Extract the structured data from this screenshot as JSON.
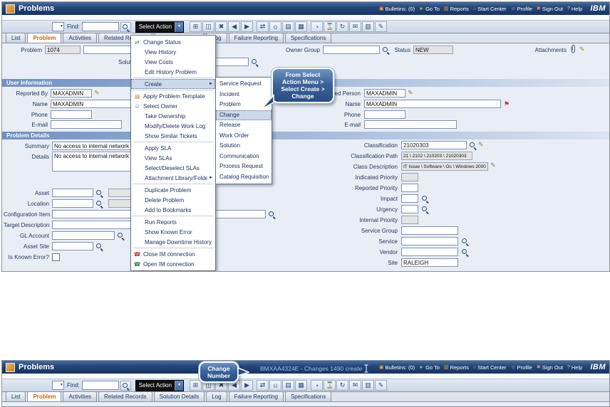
{
  "colors": {
    "titlebar": "#16335f",
    "section_header": "#7191c1",
    "active_tab_text": "#c4670f",
    "callout": "#274e83",
    "status_message_text": "#9fc2ea"
  },
  "header": {
    "app_title": "Problems",
    "logo": "IBM",
    "links": [
      {
        "label": "Bulletins: (0)",
        "glyph": "▣"
      },
      {
        "label": "Go To",
        "glyph": "►"
      },
      {
        "label": "Reports",
        "glyph": "▥"
      },
      {
        "label": "Start Center",
        "glyph": "⌂"
      },
      {
        "label": "Profile",
        "glyph": "☺"
      },
      {
        "label": "Sign Out",
        "glyph": "✖"
      },
      {
        "label": "Help",
        "glyph": "?"
      }
    ]
  },
  "toolbar": {
    "find_label": "Find:",
    "find_value": "",
    "select_action_label": "Select Action",
    "icons": [
      {
        "name": "new-record-icon",
        "glyph": "⊞"
      },
      {
        "name": "save-icon",
        "glyph": "◫"
      },
      {
        "name": "clear-changes-icon",
        "glyph": "✖"
      },
      {
        "name": "previous-record-icon",
        "glyph": "◀"
      },
      {
        "name": "next-record-icon",
        "glyph": "▶"
      },
      {
        "name": "change-status-icon",
        "glyph": "⇄"
      },
      {
        "name": "select-owner-icon",
        "glyph": "☺"
      },
      {
        "name": "detail-menu-icon",
        "glyph": "▤"
      },
      {
        "name": "kpi-icon",
        "glyph": "▦"
      },
      {
        "name": "schedule-icon",
        "glyph": "◔"
      },
      {
        "name": "timer-icon",
        "glyph": "⌛"
      },
      {
        "name": "refresh-icon",
        "glyph": "↻"
      },
      {
        "name": "communication-icon",
        "glyph": "✉"
      },
      {
        "name": "reports-icon",
        "glyph": "▥"
      },
      {
        "name": "edit-icon",
        "glyph": "✎"
      }
    ]
  },
  "tabs": [
    {
      "label": "List"
    },
    {
      "label": "Problem"
    },
    {
      "label": "Activities"
    },
    {
      "label": "Related Records"
    },
    {
      "label": "Solution Details"
    },
    {
      "label": "Log"
    },
    {
      "label": "Failure Reporting"
    },
    {
      "label": "Specifications"
    }
  ],
  "record": {
    "problem_label": "Problem",
    "problem_value": "1074",
    "problem_description_value": "",
    "solution_label": "Solution",
    "solution_value": "",
    "owner_group_label": "Owner Group",
    "owner_group_value": "",
    "status_label": "Status",
    "status_value": "NEW",
    "attachments_label": "Attachments"
  },
  "user_information": {
    "title": "User Information",
    "reported_by_label": "Reported By",
    "reported_by_value": "MAXADMIN",
    "name_label": "Name",
    "name_value": "MAXADMIN",
    "phone_label": "Phone",
    "phone_value": "",
    "email_label": "E-mail",
    "email_value": "",
    "affected_person_label": "Affected Person",
    "affected_person_value": "MAXADMIN",
    "affected_name_label": "Name",
    "affected_name_value": "MAXADMIN",
    "affected_phone_label": "Phone",
    "affected_phone_value": "",
    "affected_email_label": "E-mail",
    "affected_email_value": ""
  },
  "problem_details": {
    "title": "Problem Details",
    "summary_label": "Summary",
    "summary_value": "No access to internal network",
    "details_label": "Details",
    "details_value": "No access to internal network",
    "asset_label": "Asset",
    "asset_value": "",
    "asset_description": "",
    "location_label": "Location",
    "location_value": "",
    "location_description": "",
    "configuration_item_label": "Configuration Item",
    "configuration_item_value": "",
    "target_description_label": "Target Description",
    "target_description_value": "",
    "gl_account_label": "GL Account",
    "gl_account_value": "",
    "asset_site_label": "Asset Site",
    "asset_site_value": "",
    "is_known_error_label": "Is Known Error?",
    "classification_label": "Classification",
    "classification_value": "21020303",
    "classification_path_label": "Classification Path",
    "classification_path_value": "21 \\ 2102 \\ 210203 \\ 21020303",
    "class_description_label": "Class Description",
    "class_description_value": "IT Issue \\ Software \\ Os \\ Windows 2000",
    "indicated_priority_label": "Indicated Priority",
    "indicated_priority_value": "",
    "reported_priority_label": "Reported Priority",
    "reported_priority_value": "",
    "impact_label": "Impact",
    "impact_value": "",
    "urgency_label": "Urgency",
    "urgency_value": "",
    "internal_priority_label": "Internal Priority",
    "internal_priority_value": "",
    "service_group_label": "Service Group",
    "service_group_value": "",
    "service_label": "Service",
    "service_value": "",
    "vendor_label": "Vendor",
    "vendor_value": "",
    "site_label": "Site",
    "site_value": "RALEIGH"
  },
  "action_menu": {
    "items": [
      {
        "label": "Change Status",
        "icon": "change-status-icon",
        "glyph": "⇄"
      },
      {
        "label": "View History"
      },
      {
        "label": "View Costs"
      },
      {
        "label": "Edit History Problem"
      },
      {
        "label": "Create",
        "icon": "submenu-arrow-icon"
      },
      {
        "label": "Apply Problem Template",
        "icon": "problem-template-icon",
        "glyph": "▤"
      },
      {
        "label": "Select Owner",
        "icon": "select-owner-icon",
        "glyph": "☺"
      },
      {
        "label": "Take Ownership"
      },
      {
        "label": "Modify/Delete Work Log"
      },
      {
        "label": "Show Similar Tickets"
      },
      {
        "label": "Apply SLA"
      },
      {
        "label": "View SLAs"
      },
      {
        "label": "Select/Deselect SLAs"
      },
      {
        "label": "Attachment Library/Folders",
        "icon": "submenu-arrow-icon"
      },
      {
        "label": "Duplicate Problem"
      },
      {
        "label": "Delete Problem"
      },
      {
        "label": "Add to Bookmarks"
      },
      {
        "label": "Run Reports"
      },
      {
        "label": "Show Known Error"
      },
      {
        "label": "Manage Downtime History"
      },
      {
        "label": "Close IM connection",
        "icon": "im-close-icon",
        "glyph": "☎"
      },
      {
        "label": "Open IM connection",
        "icon": "im-open-icon",
        "glyph": "☎"
      }
    ]
  },
  "create_submenu": {
    "items": [
      {
        "label": "Service Request"
      },
      {
        "label": "Incident"
      },
      {
        "label": "Problem"
      },
      {
        "label": "Change"
      },
      {
        "label": "Release"
      },
      {
        "label": "Work Order"
      },
      {
        "label": "Solution"
      },
      {
        "label": "Communication"
      },
      {
        "label": "Process Request"
      },
      {
        "label": "Catalog Requisition"
      }
    ]
  },
  "callouts": {
    "create_change": "From Select Action Menu > Select Create > Change",
    "change_number": "Change Number"
  },
  "status_message": "BMXAA4324E - Changes 1490 create"
}
